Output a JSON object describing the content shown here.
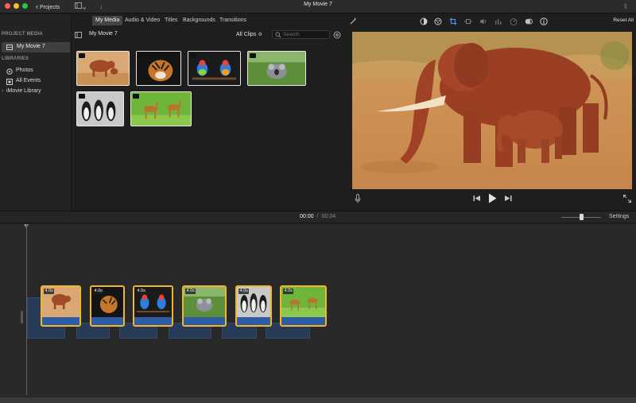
{
  "window": {
    "title": "My Movie 7",
    "projects_label": "Projects"
  },
  "tabs": [
    "My Media",
    "Audio & Video",
    "Titles",
    "Backgrounds",
    "Transitions"
  ],
  "sidebar": {
    "project_header": "PROJECT MEDIA",
    "project_item": "My Movie 7",
    "libraries_header": "LIBRARIES",
    "items": [
      "Photos",
      "All Events",
      "iMovie Library"
    ]
  },
  "browser": {
    "title": "My Movie 7",
    "filter": "All Clips ≎",
    "search_placeholder": "Search"
  },
  "media_clips": [
    "elephants",
    "tiger",
    "parrots",
    "koala",
    "penguins",
    "antelope"
  ],
  "viewer": {
    "reset_label": "Reset All"
  },
  "timeline": {
    "current_time": "00:00",
    "separator": "/",
    "total_time": "00:24",
    "settings_label": "Settings",
    "zoom_level": 0.5,
    "clips": [
      {
        "scene": "elephants",
        "duration": "4.0s"
      },
      {
        "scene": "tiger",
        "duration": "4.0s"
      },
      {
        "scene": "parrots",
        "duration": "4.0s"
      },
      {
        "scene": "koala",
        "duration": "4.0s"
      },
      {
        "scene": "penguins",
        "duration": "4.0s"
      },
      {
        "scene": "antelope",
        "duration": "4.0s"
      }
    ]
  },
  "icons": {
    "titlebar": [
      "close-icon",
      "minimize-icon",
      "maximize-icon",
      "media-browser-toggle-icon",
      "import-arrow-icon",
      "share-icon"
    ],
    "viewer_toolbar": [
      "magic-wand-icon",
      "color-balance-icon",
      "color-correction-icon",
      "crop-icon",
      "stabilization-icon",
      "volume-icon",
      "equalizer-icon",
      "speed-icon",
      "noise-reduction-icon",
      "info-icon"
    ],
    "player": [
      "microphone-icon",
      "skip-back-icon",
      "play-icon",
      "skip-forward-icon",
      "fullscreen-icon"
    ]
  },
  "colors": {
    "accent": "#f2b62e",
    "clip_audio": "#2f5ca6",
    "selection": "#3f3f41"
  }
}
